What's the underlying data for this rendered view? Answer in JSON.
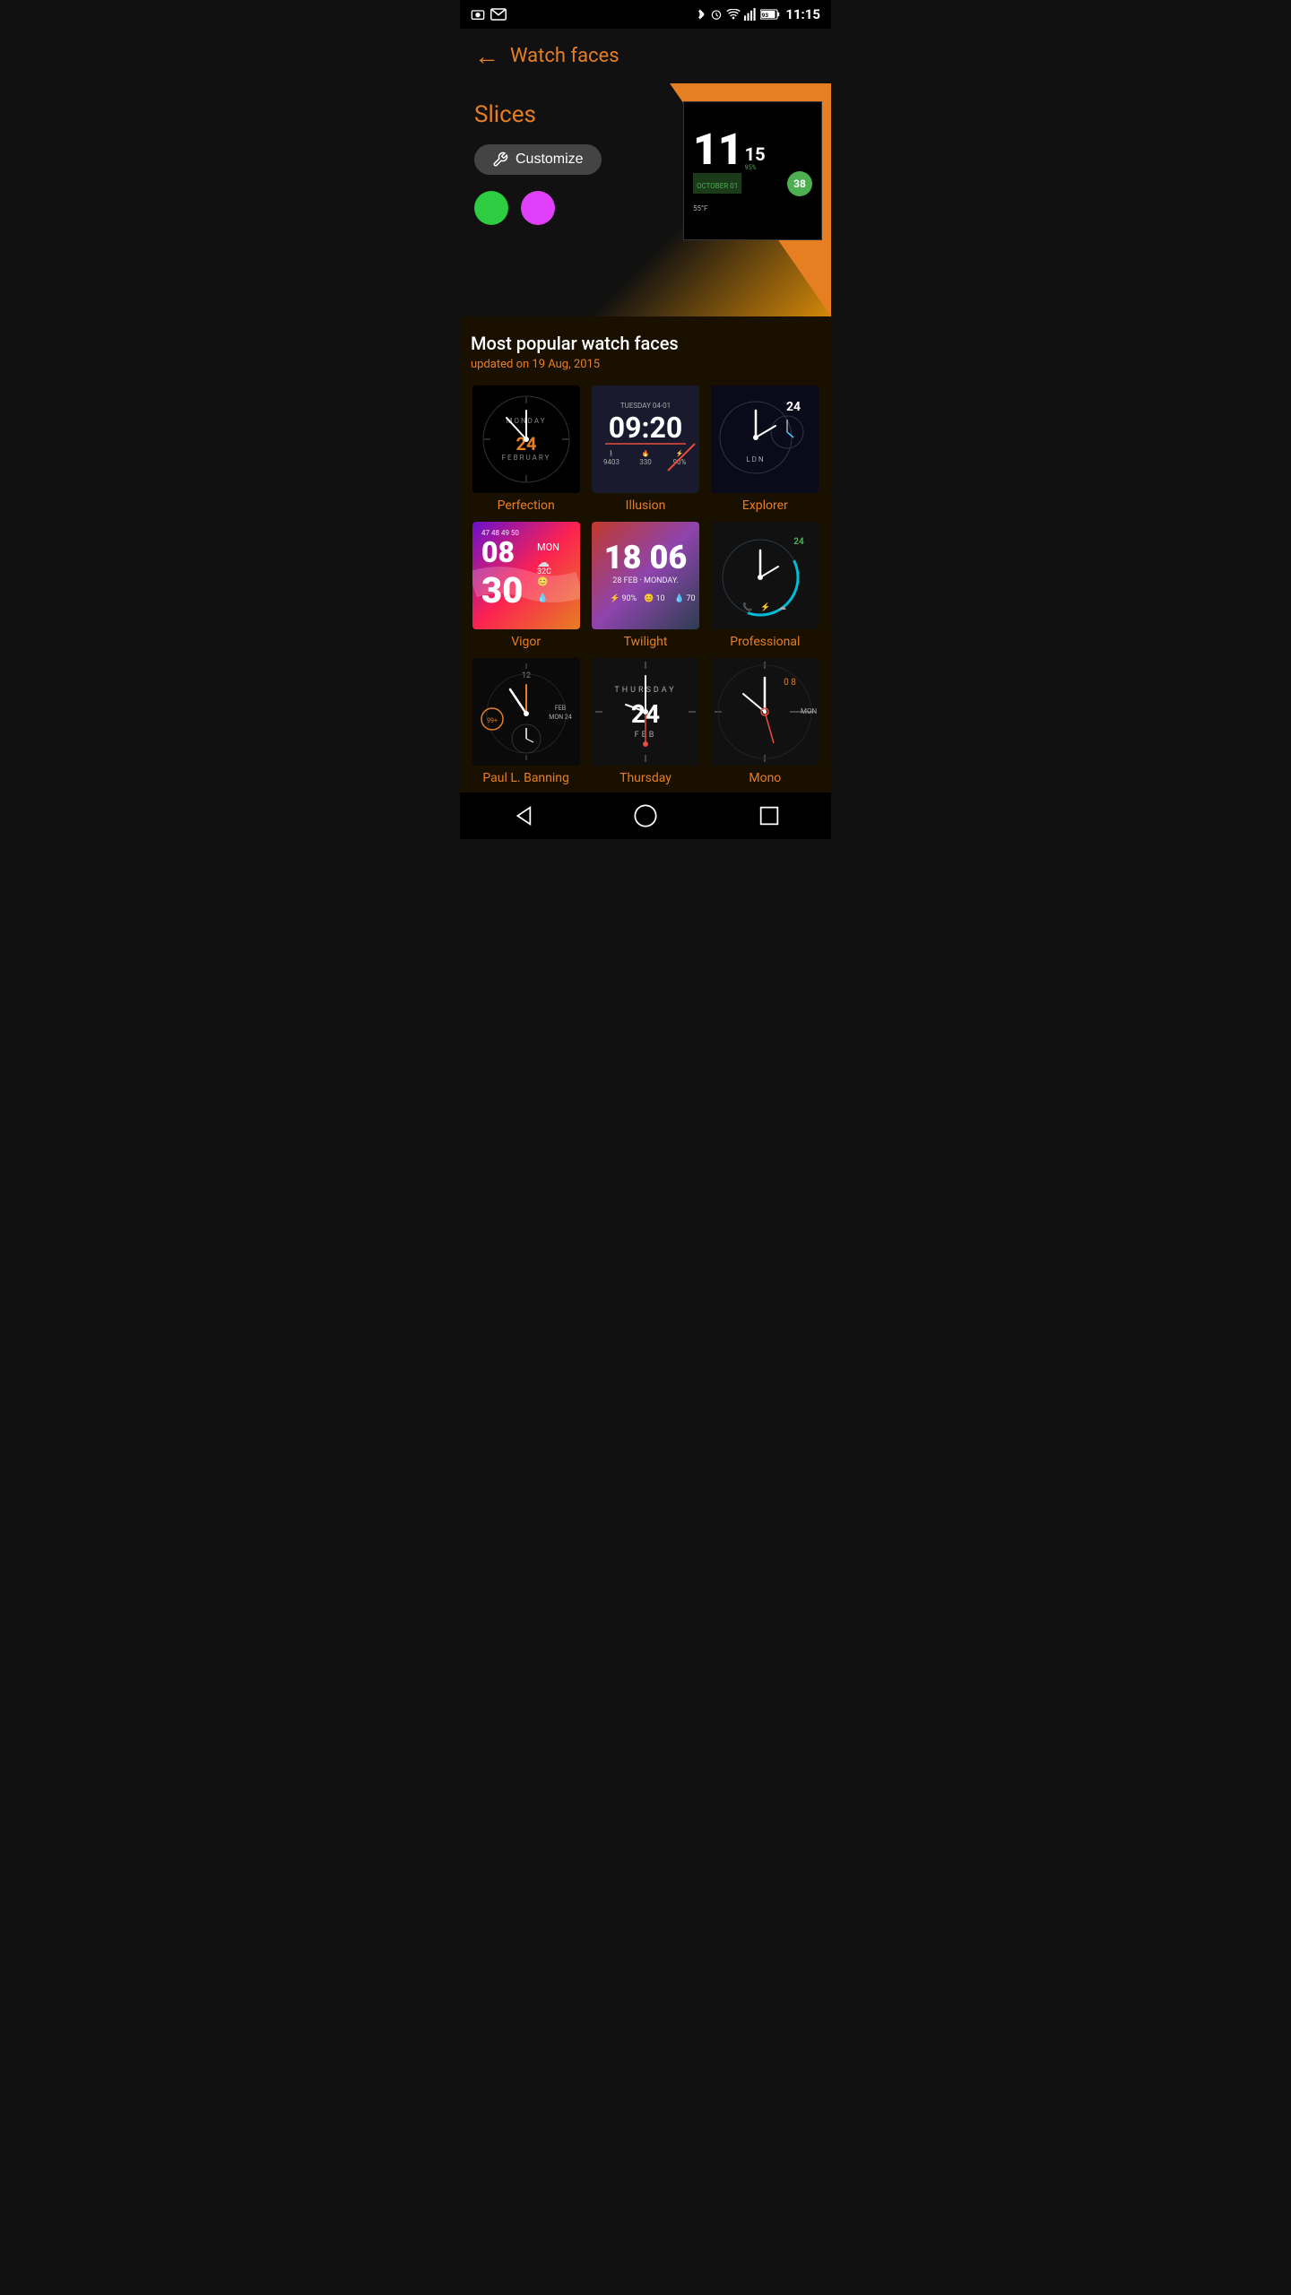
{
  "statusBar": {
    "time": "11:15",
    "battery": "93",
    "icons": [
      "photo",
      "mail",
      "bluetooth",
      "alarm",
      "wifi",
      "signal"
    ]
  },
  "header": {
    "backLabel": "←",
    "title": "Watch faces"
  },
  "hero": {
    "sectionLabel": "Slices",
    "customizeLabel": "Customize",
    "colorGreen": "#2ecc40",
    "colorMagenta": "#e040fb",
    "preview": {
      "hour": "11",
      "min": "15",
      "date": "OCTOBER 01",
      "battery": "95%",
      "temp": "55°F",
      "badge": "38"
    }
  },
  "popular": {
    "title": "Most popular watch faces",
    "subtitle": "updated on 19 Aug, 2015"
  },
  "watchFaces": [
    {
      "id": "perfection",
      "label": "Perfection",
      "style": "analog",
      "day": "MONDAY",
      "date": "24",
      "month": "FEBRUARY"
    },
    {
      "id": "illusion",
      "label": "Illusion",
      "style": "digital",
      "dateStr": "TUESDAY 04-01",
      "time": "09:20",
      "stats": [
        "9403",
        "330",
        "90%"
      ]
    },
    {
      "id": "explorer",
      "label": "Explorer",
      "style": "analog",
      "date": "24",
      "tz": "LDN"
    },
    {
      "id": "vigor",
      "label": "Vigor",
      "style": "digital",
      "hour": "08",
      "min": "MON",
      "date": "30",
      "temp": "32C",
      "stats": "47 48 49 50"
    },
    {
      "id": "twilight",
      "label": "Twilight",
      "style": "digital",
      "time": "18 06",
      "dateStr": "28 FEB · MONDAY.",
      "stats": [
        "90%",
        "10",
        "70"
      ]
    },
    {
      "id": "professional",
      "label": "Professional",
      "style": "analog",
      "date": "24"
    },
    {
      "id": "paulbanning",
      "label": "Paul L. Banning",
      "style": "analog"
    },
    {
      "id": "thursday",
      "label": "Thursday",
      "style": "minimal",
      "day": "THURSDAY",
      "date": "24",
      "month": "FEB"
    },
    {
      "id": "mono",
      "label": "Mono",
      "style": "analog",
      "date": "MON"
    }
  ],
  "bottomNav": {
    "back": "◁",
    "home": "○",
    "recent": "□"
  }
}
